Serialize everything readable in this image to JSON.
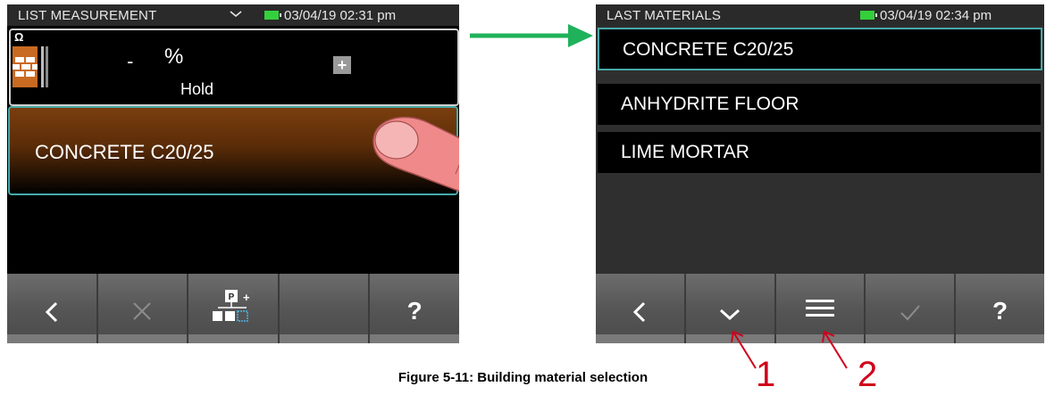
{
  "left_screen": {
    "status": {
      "title": "LIST MEASUREMENT",
      "datetime": "03/04/19 02:31 pm"
    },
    "measurement": {
      "omega": "Ω",
      "value": "-",
      "unit": "%",
      "mode": "Hold",
      "plus": "+"
    },
    "material": {
      "label": "CONCRETE C20/25"
    },
    "toolbar": {
      "help": "?"
    }
  },
  "right_screen": {
    "status": {
      "title": "LAST MATERIALS",
      "datetime": "03/04/19 02:34 pm"
    },
    "list": [
      "CONCRETE C20/25",
      "ANHYDRITE FLOOR",
      "LIME MORTAR"
    ],
    "toolbar": {
      "help": "?"
    }
  },
  "caption": "Figure 5-11: Building material selection",
  "callouts": {
    "one": "1",
    "two": "2"
  },
  "colors": {
    "accent": "#49a9a9",
    "battery": "#34d03c",
    "arrow_green": "#1fb25a",
    "callout_red": "#d0021b",
    "brick": "#c96a22"
  },
  "icons": {
    "back": "chevron-left-icon",
    "cancel": "x-icon",
    "tree": "hierarchy-icon",
    "down": "chevron-down-icon",
    "menu": "menu-icon",
    "confirm": "check-icon"
  }
}
